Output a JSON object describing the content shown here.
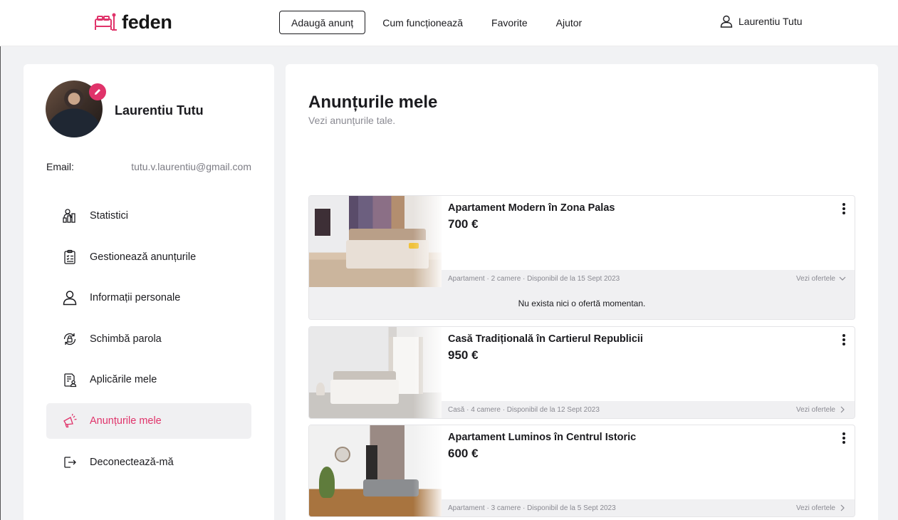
{
  "header": {
    "logo_text": "feden",
    "add_button": "Adaugă anunț",
    "nav": [
      "Cum funcționează",
      "Favorite",
      "Ajutor"
    ],
    "user_name": "Laurentiu Tutu",
    "accent": "#e0336a"
  },
  "sidebar": {
    "profile_name": "Laurentiu Tutu",
    "email_label": "Email:",
    "email_value": "tutu.v.laurentiu@gmail.com",
    "menu": [
      {
        "label": "Statistici",
        "icon": "statistics-icon",
        "active": false
      },
      {
        "label": "Gestionează anunțurile",
        "icon": "clipboard-list-icon",
        "active": false
      },
      {
        "label": "Informații personale",
        "icon": "user-icon",
        "active": false
      },
      {
        "label": "Schimbă parola",
        "icon": "lock-refresh-icon",
        "active": false
      },
      {
        "label": "Aplicările mele",
        "icon": "document-user-icon",
        "active": false
      },
      {
        "label": "Anunțurile mele",
        "icon": "megaphone-icon",
        "active": true
      },
      {
        "label": "Deconectează-mă",
        "icon": "logout-icon",
        "active": false
      }
    ]
  },
  "main": {
    "title": "Anunțurile mele",
    "subtitle": "Vezi anunțurile tale.",
    "listings": [
      {
        "title": "Apartament Modern în Zona Palas",
        "price": "700 €",
        "meta": "Apartament · 2 camere · Disponibil de la 15 Sept 2023",
        "offers_label": "Vezi ofertele",
        "expanded": true,
        "offers_text": "Nu exista nici o ofertă momentan."
      },
      {
        "title": "Casă Tradițională în Cartierul Republicii",
        "price": "950 €",
        "meta": "Casă · 4 camere · Disponibil de la 12 Sept 2023",
        "offers_label": "Vezi ofertele",
        "expanded": false
      },
      {
        "title": "Apartament Luminos în Centrul Istoric",
        "price": "600 €",
        "meta": "Apartament · 3 camere · Disponibil de la 5 Sept 2023",
        "offers_label": "Vezi ofertele",
        "expanded": false
      }
    ]
  }
}
